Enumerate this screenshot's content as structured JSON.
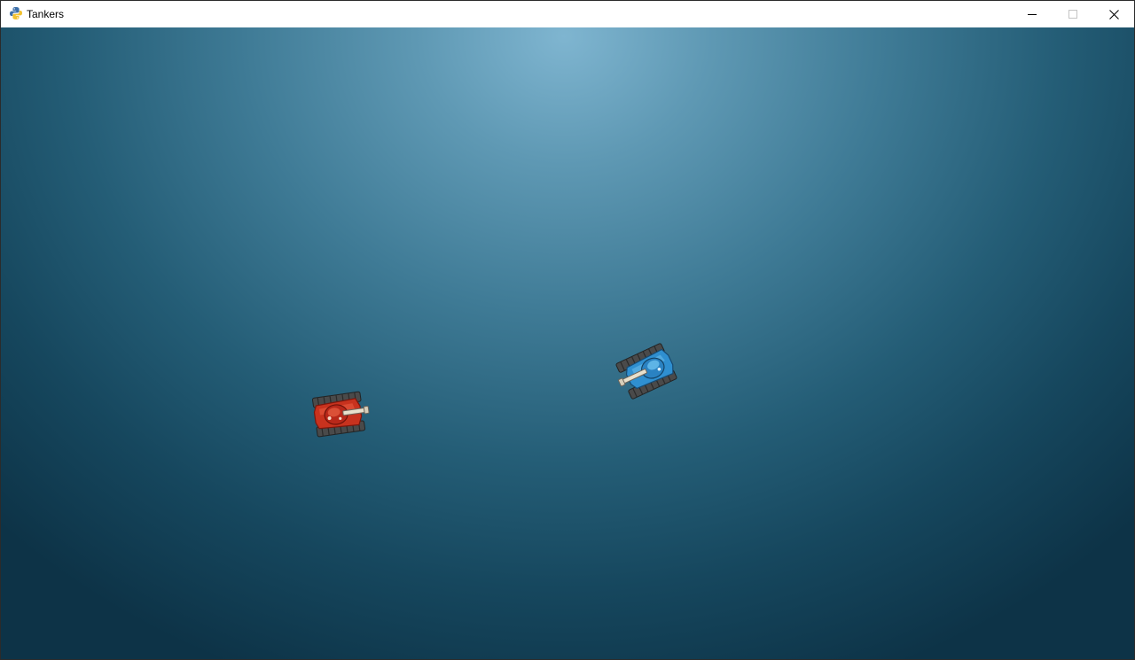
{
  "window": {
    "title": "Tankers",
    "app_icon": "python-icon",
    "controls": {
      "minimize": "minimize-icon",
      "maximize": "maximize-icon",
      "close": "close-icon"
    }
  },
  "game": {
    "players": [
      {
        "team": "red",
        "color": "#c8321e"
      },
      {
        "team": "blue",
        "color": "#2f8fd0"
      }
    ]
  }
}
